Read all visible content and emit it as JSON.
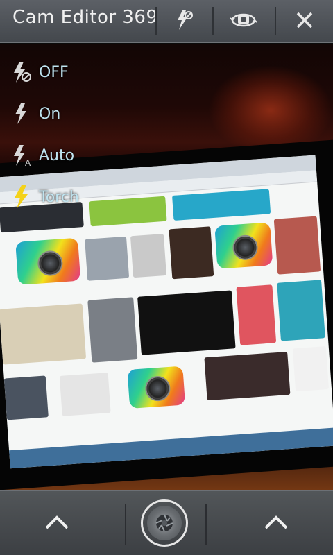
{
  "app": {
    "title": "Cam Editor 369"
  },
  "toolbar": {
    "flash_icon": "flash-off-icon",
    "switch_camera_icon": "switch-camera-icon",
    "close_icon": "close-icon"
  },
  "flash_menu": {
    "items": [
      {
        "label": "OFF",
        "icon": "flash-off-icon"
      },
      {
        "label": "On",
        "icon": "flash-on-icon"
      },
      {
        "label": "Auto",
        "icon": "flash-auto-icon"
      },
      {
        "label": "Torch",
        "icon": "torch-icon",
        "active_color": "#f4d21a"
      }
    ]
  },
  "bottom_bar": {
    "left_icon": "chevron-up-icon",
    "shutter_icon": "shutter-icon",
    "right_icon": "chevron-up-icon"
  },
  "colors": {
    "bar_bg": "#4b4f54",
    "menu_text": "#bfe3ef",
    "torch_accent": "#f4d21a"
  }
}
